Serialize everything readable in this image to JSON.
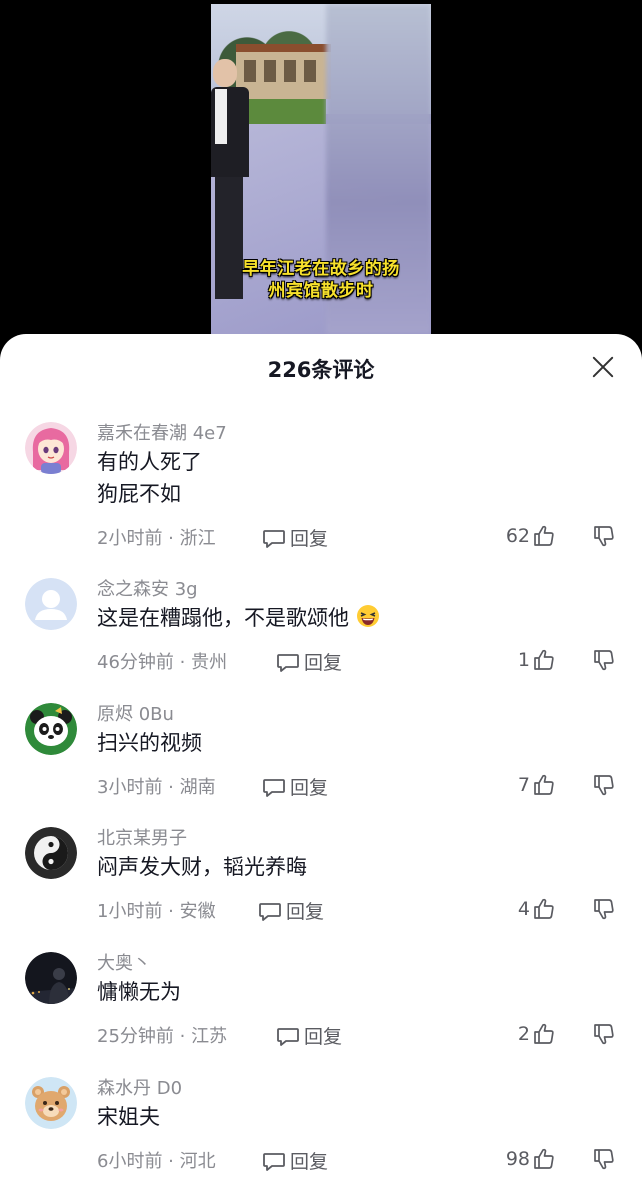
{
  "video": {
    "caption_line1": "早年江老在故乡的扬",
    "caption_line2": "州宾馆散步时"
  },
  "header": {
    "title": "226条评论"
  },
  "reply_label": "回复",
  "comments": [
    {
      "username": "嘉禾在春潮 4e7",
      "lines": [
        "有的人死了",
        "狗屁不如"
      ],
      "meta": "2小时前 · 浙江",
      "likes": "62",
      "avatar": "anime-girl"
    },
    {
      "username": "念之森安 3g",
      "lines": [
        "这是在糟蹋他，不是歌颂他"
      ],
      "emoji": "laughing-emoji",
      "meta": "46分钟前 · 贵州",
      "likes": "1",
      "avatar": "default-user"
    },
    {
      "username": "原烬 0Bu",
      "lines": [
        "扫兴的视频"
      ],
      "meta": "3小时前 · 湖南",
      "likes": "7",
      "avatar": "panda"
    },
    {
      "username": "北京某男子",
      "lines": [
        "闷声发大财，韬光养晦"
      ],
      "meta": "1小时前 · 安徽",
      "likes": "4",
      "avatar": "yin-yang"
    },
    {
      "username": "大奥丶",
      "lines": [
        "慵懒无为"
      ],
      "meta": "25分钟前 · 江苏",
      "likes": "2",
      "avatar": "night-photo"
    },
    {
      "username": "森水丹 D0",
      "lines": [
        "宋姐夫"
      ],
      "meta": "6小时前 · 河北",
      "likes": "98",
      "avatar": "bear"
    }
  ]
}
